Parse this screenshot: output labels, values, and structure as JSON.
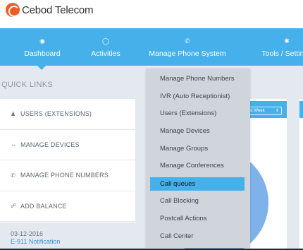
{
  "brand": {
    "name": "Cebod Telecom"
  },
  "nav": [
    {
      "label": "Dashboard",
      "icon": "dashboard-icon"
    },
    {
      "label": "Activities",
      "icon": "clock-icon"
    },
    {
      "label": "Manage Phone System",
      "icon": "phone-icon"
    },
    {
      "label": "Tools / Settings",
      "icon": "gear-icon"
    }
  ],
  "quick_links": {
    "title": "QUICK LINKS",
    "items": [
      {
        "label": "USERS (EXTENSIONS)",
        "icon": "user-icon"
      },
      {
        "label": "MANAGE DEVICES",
        "icon": "arrows-icon"
      },
      {
        "label": "MANAGE PHONE NUMBERS",
        "icon": "phone-icon"
      },
      {
        "label": "ADD BALANCE",
        "icon": "link-icon"
      }
    ]
  },
  "notice": {
    "date": "03-12-2016",
    "title": "E-911 Notification"
  },
  "panel": {
    "select_value": "st Week",
    "select_arrow": "⇕"
  },
  "dropdown": {
    "items": [
      "Manage Phone Numbers",
      "IVR (Auto Receptionist)",
      "Users (Extensions)",
      "Manage Devices",
      "Manage Groups",
      "Manage Conferences",
      "Call queues",
      "Call Blocking",
      "Postcall Actions",
      "Call Center"
    ],
    "active": "Call queues"
  },
  "colors": {
    "accent": "#45b0e9",
    "brand": "#f05a24",
    "pie": "#7fb2ea"
  }
}
